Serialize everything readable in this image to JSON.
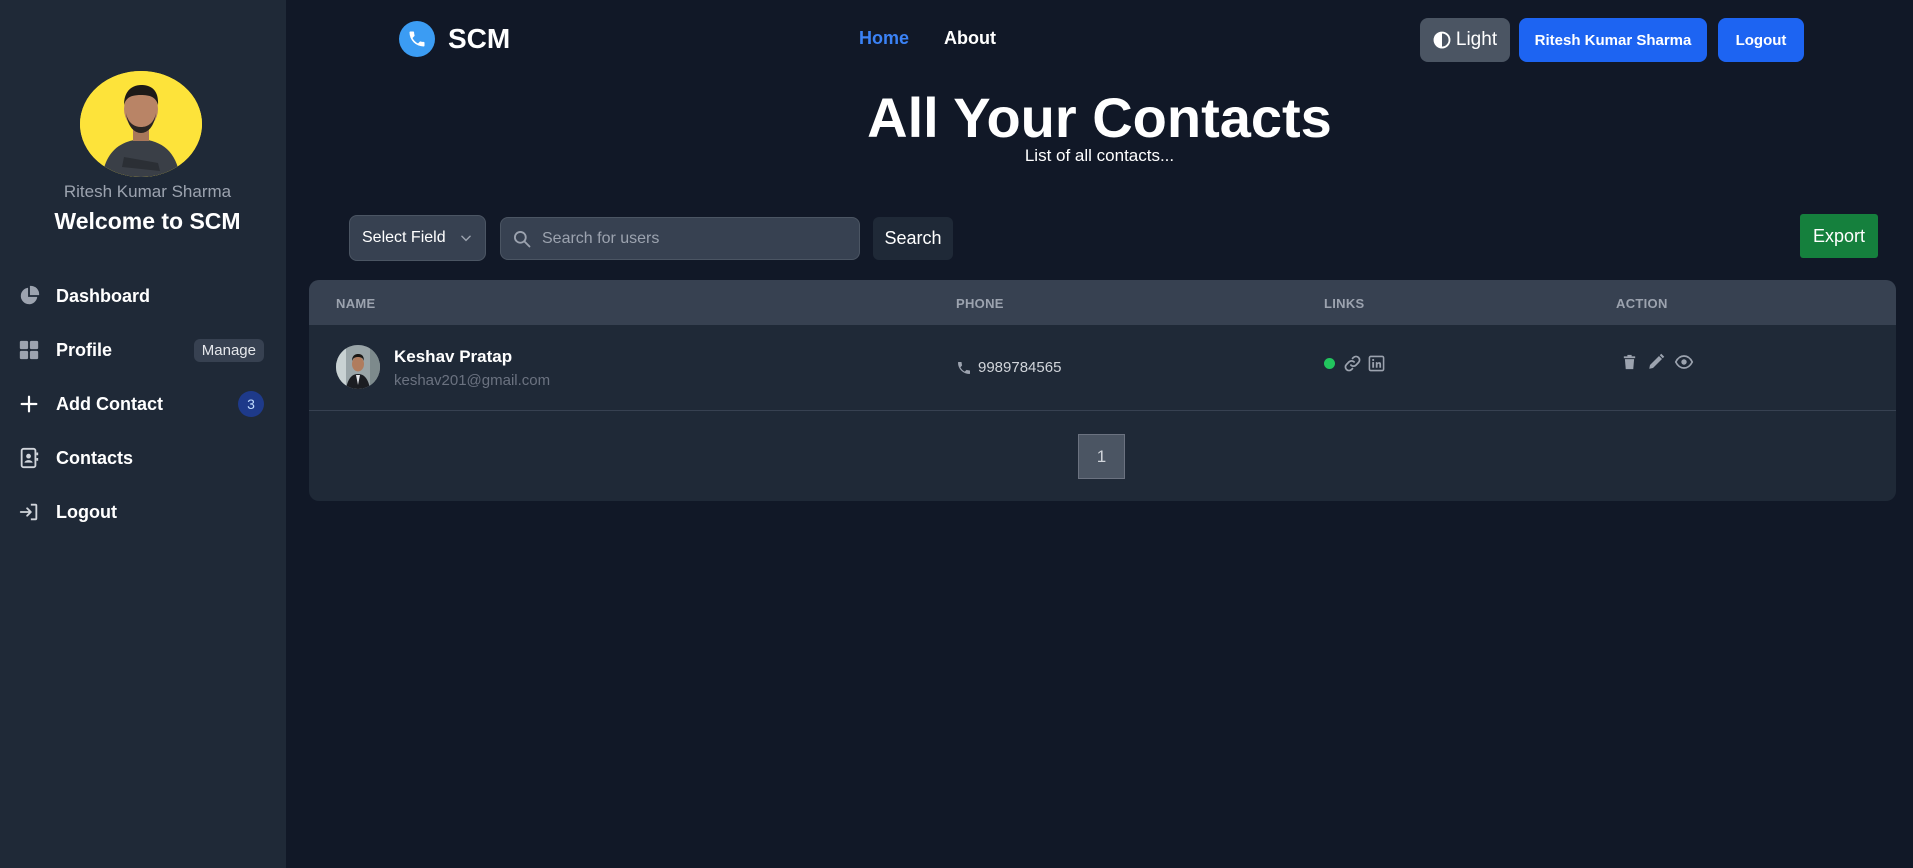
{
  "sidebar": {
    "username": "Ritesh Kumar Sharma",
    "welcome": "Welcome to SCM",
    "items": [
      {
        "label": "Dashboard",
        "icon": "pie-chart-icon"
      },
      {
        "label": "Profile",
        "icon": "grid-icon",
        "badge": "Manage"
      },
      {
        "label": "Add Contact",
        "icon": "plus-icon",
        "badge": "3"
      },
      {
        "label": "Contacts",
        "icon": "contact-book-icon"
      },
      {
        "label": "Logout",
        "icon": "logout-icon"
      }
    ]
  },
  "navbar": {
    "brand": "SCM",
    "links": [
      {
        "label": "Home",
        "active": true
      },
      {
        "label": "About",
        "active": false
      }
    ],
    "theme_button": "Light",
    "user_button": "Ritesh Kumar Sharma",
    "logout_button": "Logout"
  },
  "main": {
    "title": "All Your Contacts",
    "subtitle": "List of all contacts...",
    "select_field": "Select Field",
    "search_placeholder": "Search for users",
    "search_button": "Search",
    "export_button": "Export"
  },
  "table": {
    "headers": [
      "NAME",
      "PHONE",
      "LINKS",
      "ACTION"
    ],
    "rows": [
      {
        "name": "Keshav Pratap",
        "email": "keshav201@gmail.com",
        "phone": "9989784565",
        "favorite": true
      }
    ],
    "pages": [
      "1"
    ]
  },
  "colors": {
    "background": "#111827",
    "sidebar": "#1f2937",
    "accent_blue": "#1d64f2",
    "active_link": "#3b82f6",
    "export_green": "#15803d",
    "status_green": "#22c55e"
  }
}
